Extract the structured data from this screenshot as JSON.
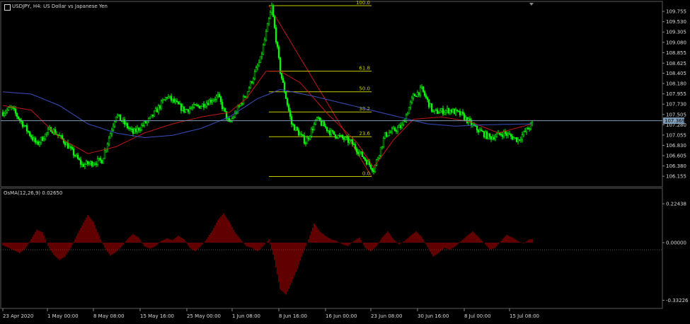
{
  "header": {
    "symbol_title": "USDJPY, H4:  US Dollar vs Japanese Yen",
    "indicator_title": "OsMA(12,26,9) 0.02650"
  },
  "colors": {
    "background": "#000000",
    "bull_candle": "#00ff00",
    "bear_candle": "#00ff00",
    "ma_fast": "#c01818",
    "ma_slow": "#3a4fbf",
    "fib": "#c8c800",
    "osma": "#c00000",
    "grid_text": "#d8d8d8",
    "price_line": "#7f9db9"
  },
  "chart_data": [
    {
      "type": "candlestick",
      "title": "USDJPY, H4:  US Dollar vs Japanese Yen",
      "current_price": "107.369",
      "y_axis_ticks": [
        "109.755",
        "109.530",
        "109.305",
        "109.080",
        "108.855",
        "108.625",
        "108.405",
        "108.180",
        "107.955",
        "107.730",
        "107.505",
        "107.280",
        "107.055",
        "106.830",
        "106.605",
        "106.380",
        "106.155"
      ],
      "ylim": [
        106.05,
        109.88
      ],
      "x_axis_ticks": [
        "23 Apr 2020",
        "1 May 00:00",
        "8 May 08:00",
        "15 May 16:00",
        "25 May 00:00",
        "1 Jun 08:00",
        "8 Jun 16:00",
        "16 Jun 00:00",
        "23 Jun 08:00",
        "30 Jun 16:00",
        "8 Jul 00:00",
        "15 Jul 08:00"
      ],
      "price_path": [
        [
          0,
          107.55
        ],
        [
          6,
          107.65
        ],
        [
          14,
          107.3
        ],
        [
          24,
          106.85
        ],
        [
          34,
          107.2
        ],
        [
          44,
          106.9
        ],
        [
          56,
          106.4
        ],
        [
          70,
          106.5
        ],
        [
          80,
          107.5
        ],
        [
          92,
          107.1
        ],
        [
          104,
          107.4
        ],
        [
          116,
          107.9
        ],
        [
          128,
          107.6
        ],
        [
          140,
          107.7
        ],
        [
          152,
          107.9
        ],
        [
          160,
          107.3
        ],
        [
          172,
          107.95
        ],
        [
          182,
          108.7
        ],
        [
          190,
          109.85
        ],
        [
          196,
          108.45
        ],
        [
          204,
          107.3
        ],
        [
          214,
          106.9
        ],
        [
          222,
          107.4
        ],
        [
          232,
          107.1
        ],
        [
          246,
          106.9
        ],
        [
          262,
          106.3
        ],
        [
          270,
          107.05
        ],
        [
          282,
          107.25
        ],
        [
          290,
          107.9
        ],
        [
          296,
          108.05
        ],
        [
          304,
          107.55
        ],
        [
          316,
          107.6
        ],
        [
          324,
          107.5
        ],
        [
          334,
          107.2
        ],
        [
          344,
          107.0
        ],
        [
          354,
          107.1
        ],
        [
          364,
          106.95
        ],
        [
          374,
          107.3
        ]
      ],
      "fibonacci": [
        {
          "level": "100.0",
          "price": 109.88
        },
        {
          "level": "61.8",
          "price": 108.45
        },
        {
          "level": "50.0",
          "price": 108.0
        },
        {
          "level": "38.2",
          "price": 107.56
        },
        {
          "level": "23.6",
          "price": 107.02
        },
        {
          "level": "0.0",
          "price": 106.15
        }
      ],
      "moving_averages": [
        {
          "path": [
            [
              0,
              107.7
            ],
            [
              20,
              107.6
            ],
            [
              40,
              107.0
            ],
            [
              60,
              106.65
            ],
            [
              80,
              106.8
            ],
            [
              100,
              107.1
            ],
            [
              120,
              107.3
            ],
            [
              140,
              107.45
            ],
            [
              160,
              107.55
            ],
            [
              172,
              107.85
            ],
            [
              186,
              108.45
            ],
            [
              196,
              108.45
            ],
            [
              210,
              108.2
            ],
            [
              230,
              107.5
            ],
            [
              250,
              106.9
            ],
            [
              262,
              106.35
            ],
            [
              276,
              106.95
            ],
            [
              290,
              107.4
            ],
            [
              310,
              107.45
            ],
            [
              330,
              107.35
            ],
            [
              350,
              107.1
            ],
            [
              374,
              107.3
            ]
          ]
        },
        {
          "path": [
            [
              0,
              108.0
            ],
            [
              20,
              107.95
            ],
            [
              40,
              107.7
            ],
            [
              60,
              107.3
            ],
            [
              80,
              107.1
            ],
            [
              100,
              107.0
            ],
            [
              120,
              107.05
            ],
            [
              140,
              107.2
            ],
            [
              160,
              107.45
            ],
            [
              180,
              107.85
            ],
            [
              196,
              108.05
            ],
            [
              220,
              107.9
            ],
            [
              240,
              107.75
            ],
            [
              260,
              107.6
            ],
            [
              280,
              107.45
            ],
            [
              300,
              107.3
            ],
            [
              320,
              107.25
            ],
            [
              340,
              107.28
            ],
            [
              374,
              107.3
            ]
          ]
        }
      ]
    },
    {
      "type": "bar",
      "title": "OsMA(12,26,9) 0.02650",
      "y_axis_ticks": [
        "0.22438",
        "0.00000",
        "-0.33226"
      ],
      "ylim": [
        -0.355,
        0.245
      ],
      "x": [
        0,
        4,
        8,
        12,
        16,
        20,
        24,
        28,
        32,
        36,
        40,
        44,
        48,
        52,
        56,
        60,
        64,
        68,
        72,
        76,
        80,
        84,
        88,
        92,
        96,
        100,
        104,
        108,
        112,
        116,
        120,
        124,
        128,
        132,
        136,
        140,
        144,
        148,
        152,
        156,
        160,
        164,
        168,
        172,
        176,
        180,
        184,
        188,
        192,
        196,
        200,
        204,
        208,
        212,
        216,
        220,
        224,
        228,
        232,
        236,
        240,
        244,
        248,
        252,
        256,
        260,
        264,
        268,
        272,
        276,
        280,
        284,
        288,
        292,
        296,
        300,
        304,
        308,
        312,
        316,
        320,
        324,
        328,
        332,
        336,
        340,
        344,
        348,
        352,
        356,
        360,
        364,
        368,
        372
      ],
      "values": [
        -0.015,
        -0.03,
        -0.045,
        -0.06,
        -0.035,
        0.02,
        0.075,
        0.06,
        -0.02,
        -0.07,
        -0.1,
        -0.08,
        -0.03,
        0.04,
        0.1,
        0.16,
        0.12,
        0.04,
        -0.03,
        -0.075,
        -0.055,
        -0.02,
        0.02,
        0.05,
        0.03,
        -0.02,
        -0.035,
        -0.02,
        0.01,
        0.025,
        0.015,
        0.04,
        0.02,
        -0.03,
        -0.05,
        -0.02,
        0.02,
        0.07,
        0.13,
        0.17,
        0.12,
        0.06,
        0.02,
        -0.02,
        -0.03,
        -0.05,
        -0.02,
        0.02,
        -0.1,
        -0.27,
        -0.3,
        -0.23,
        -0.15,
        -0.06,
        0.02,
        0.11,
        0.065,
        0.04,
        0.02,
        0.01,
        -0.01,
        -0.02,
        0.01,
        0.03,
        -0.03,
        -0.05,
        -0.02,
        0.03,
        0.065,
        0.02,
        -0.01,
        0.01,
        0.04,
        0.065,
        0.035,
        -0.025,
        -0.08,
        -0.06,
        -0.03,
        -0.04,
        -0.02,
        0.01,
        0.04,
        0.065,
        0.035,
        0.0,
        -0.04,
        -0.03,
        0.01,
        0.045,
        0.03,
        0.01,
        -0.005,
        0.02
      ]
    }
  ]
}
